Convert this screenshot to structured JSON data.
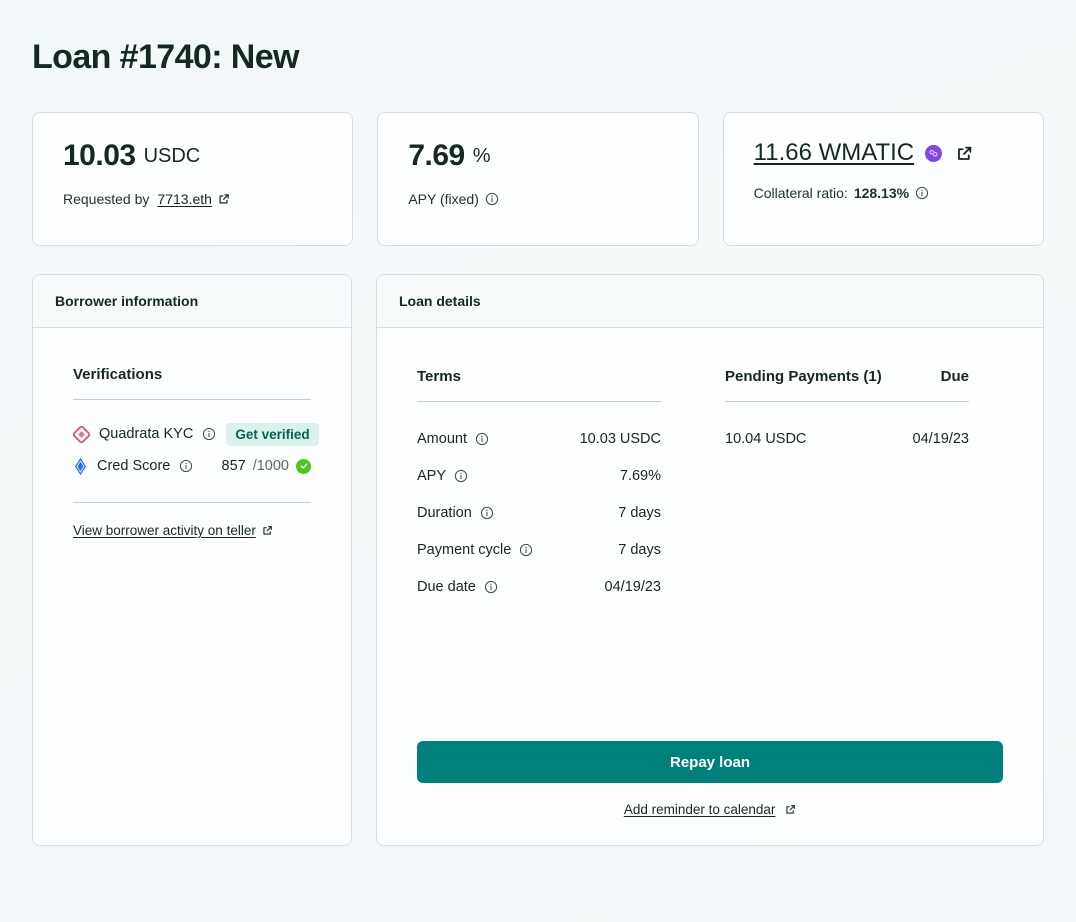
{
  "page": {
    "title": "Loan #1740: New"
  },
  "stats": {
    "amount": {
      "value": "10.03",
      "unit": "USDC",
      "sub_prefix": "Requested by",
      "sub_link": "7713.eth",
      "link_icon": "external-link-icon"
    },
    "apy": {
      "value": "7.69",
      "unit": "%",
      "sub_label": "APY (fixed)",
      "info_icon": "info-icon"
    },
    "collateral": {
      "link_text": "11.66 WMATIC",
      "chain_icon": "polygon-icon",
      "link_icon": "external-link-icon",
      "sub_prefix": "Collateral ratio:",
      "sub_value": "128.13%",
      "info_icon": "info-icon"
    }
  },
  "borrower_panel": {
    "header": "Borrower information",
    "section_title": "Verifications",
    "verifications": [
      {
        "icon": "quadrata-icon",
        "label": "Quadrata KYC",
        "info_icon": "info-icon",
        "action_label": "Get verified"
      },
      {
        "icon": "cred-score-icon",
        "label": "Cred Score",
        "info_icon": "info-icon",
        "score": "857",
        "score_max": "/1000",
        "status_icon": "check-circle-icon"
      }
    ],
    "activity_link": "View borrower activity on teller",
    "activity_link_icon": "external-link-icon"
  },
  "details_panel": {
    "header": "Loan details",
    "terms": {
      "title": "Terms",
      "rows": [
        {
          "label": "Amount",
          "info_icon": "info-icon",
          "value": "10.03 USDC"
        },
        {
          "label": "APY",
          "info_icon": "info-icon",
          "value": "7.69%"
        },
        {
          "label": "Duration",
          "info_icon": "info-icon",
          "value": "7 days"
        },
        {
          "label": "Payment cycle",
          "info_icon": "info-icon",
          "value": "7 days"
        },
        {
          "label": "Due date",
          "info_icon": "info-icon",
          "value": "04/19/23"
        }
      ]
    },
    "payments": {
      "title": "Pending Payments (1)",
      "due_header": "Due",
      "rows": [
        {
          "amount": "10.04 USDC",
          "due": "04/19/23"
        }
      ]
    },
    "repay_button": "Repay loan",
    "calendar_link": "Add reminder to calendar",
    "calendar_link_icon": "external-link-icon"
  },
  "colors": {
    "accent_teal": "#00807d",
    "badge_bg": "#d9f2ec",
    "badge_text": "#0d5f52",
    "polygon_purple": "#8247e5",
    "success_green": "#4bc51f",
    "title_ink": "#14291f",
    "page_bg": "#f4f8fa"
  }
}
